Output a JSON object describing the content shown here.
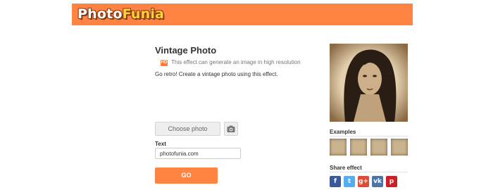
{
  "brand": {
    "part1": "Photo",
    "part2": "Funia"
  },
  "effect": {
    "title": "Vintage Photo",
    "hd_badge": "HD",
    "hd_text": "This effect can generate an image in high resolution",
    "description": "Go retro! Create a vintage photo using this effect."
  },
  "form": {
    "choose_photo_label": "Choose photo",
    "camera_icon": "camera-icon",
    "text_label": "Text",
    "text_value": "photofunia.com",
    "go_label": "GO"
  },
  "sidebar": {
    "examples_label": "Examples",
    "share_label": "Share effect",
    "share_buttons": [
      {
        "name": "facebook",
        "glyph": "f",
        "color": "#3b5998"
      },
      {
        "name": "twitter",
        "glyph": "t",
        "color": "#55acee"
      },
      {
        "name": "google-plus",
        "glyph": "g+",
        "color": "#dd4b39"
      },
      {
        "name": "vk",
        "glyph": "vk",
        "color": "#4c75a3"
      },
      {
        "name": "pinterest",
        "glyph": "p",
        "color": "#cb2027"
      }
    ]
  },
  "colors": {
    "accent": "#ff8443",
    "logo_secondary": "#ffd23b"
  }
}
